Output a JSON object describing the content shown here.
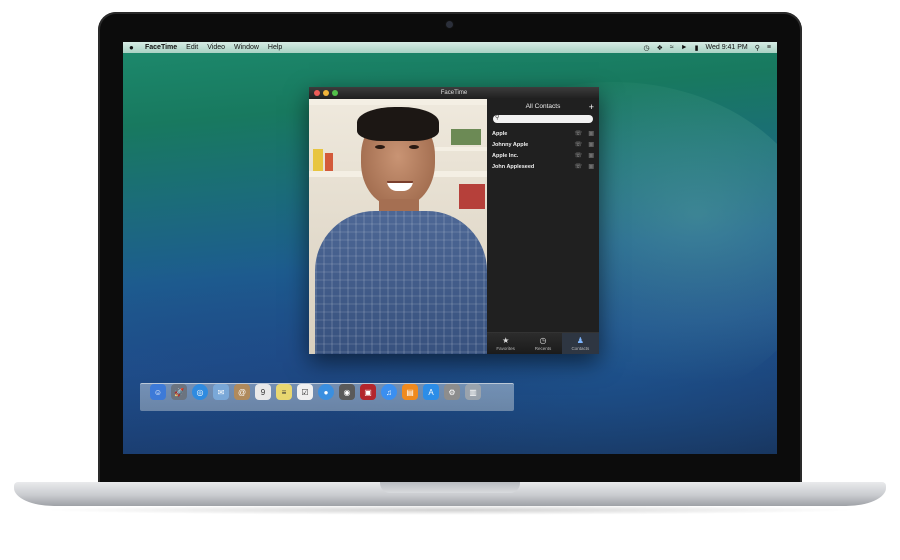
{
  "menubar": {
    "items": [
      "FaceTime",
      "Edit",
      "Video",
      "Window",
      "Help"
    ],
    "clock": "Wed 9:41 PM"
  },
  "facetime": {
    "window_title": "FaceTime",
    "panel_title": "All Contacts",
    "search_placeholder": "",
    "contacts": [
      {
        "name": "Apple"
      },
      {
        "name": "Johnny Apple"
      },
      {
        "name": "Apple Inc."
      },
      {
        "name": "John Appleseed"
      }
    ],
    "tabs": [
      {
        "label": "Favorites",
        "icon": "star-icon",
        "active": false
      },
      {
        "label": "Recents",
        "icon": "clock-icon",
        "active": false
      },
      {
        "label": "Contacts",
        "icon": "person-icon",
        "active": true
      }
    ]
  },
  "dock": {
    "apps": [
      {
        "name": "finder-icon",
        "glyph": "☺",
        "color": "#3d7ad8"
      },
      {
        "name": "launchpad-icon",
        "glyph": "🚀",
        "color": "#6b7480"
      },
      {
        "name": "safari-icon",
        "glyph": "◎",
        "color": "#2f8be0"
      },
      {
        "name": "mail-icon",
        "glyph": "✉",
        "color": "#7aa8d8"
      },
      {
        "name": "contacts-icon",
        "glyph": "@",
        "color": "#b08a5c"
      },
      {
        "name": "calendar-icon",
        "glyph": "9",
        "color": "#e9e9e9"
      },
      {
        "name": "notes-icon",
        "glyph": "≡",
        "color": "#e8d770"
      },
      {
        "name": "reminders-icon",
        "glyph": "☑",
        "color": "#f0f0f0"
      },
      {
        "name": "messages-icon",
        "glyph": "●",
        "color": "#3a8fe0"
      },
      {
        "name": "facetime-icon",
        "glyph": "◉",
        "color": "#5a5a5a"
      },
      {
        "name": "photo-booth-icon",
        "glyph": "▣",
        "color": "#b3262c"
      },
      {
        "name": "itunes-icon",
        "glyph": "♫",
        "color": "#3b8ff0"
      },
      {
        "name": "ibooks-icon",
        "glyph": "▤",
        "color": "#f08a1e"
      },
      {
        "name": "app-store-icon",
        "glyph": "A",
        "color": "#2c8de8"
      },
      {
        "name": "system-preferences-icon",
        "glyph": "⚙",
        "color": "#8d8d8d"
      },
      {
        "name": "trash-icon",
        "glyph": "▥",
        "color": "#9aa3ad"
      }
    ]
  }
}
